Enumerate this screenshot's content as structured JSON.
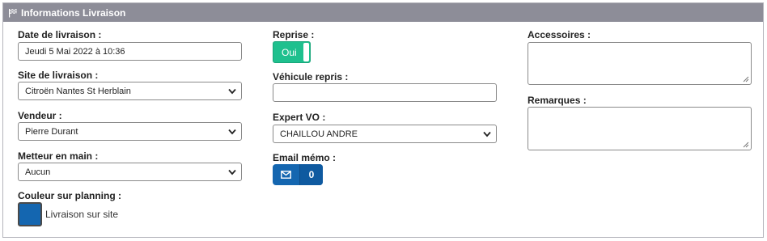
{
  "panel": {
    "title": "Informations Livraison",
    "icon": "flag-icon"
  },
  "col1": {
    "date_label": "Date de livraison :",
    "date_value": "Jeudi 5 Mai 2022 à 10:36",
    "site_label": "Site de livraison :",
    "site_value": "Citroën Nantes St Herblain",
    "vendeur_label": "Vendeur :",
    "vendeur_value": "Pierre Durant",
    "metteur_label": "Metteur en main :",
    "metteur_value": "Aucun",
    "couleur_label": "Couleur sur planning :",
    "couleur_value": "Livraison sur site",
    "couleur_color": "#1466b0"
  },
  "col2": {
    "reprise_label": "Reprise :",
    "reprise_value": "Oui",
    "reprise_color": "#1fc08e",
    "vehicule_label": "Véhicule repris :",
    "vehicule_value": "",
    "expert_label": "Expert VO :",
    "expert_value": "CHAILLOU ANDRE",
    "email_label": "Email mémo :",
    "email_count": "0",
    "email_icon": "envelope-icon"
  },
  "col3": {
    "accessoires_label": "Accessoires :",
    "accessoires_value": "",
    "remarques_label": "Remarques :",
    "remarques_value": ""
  }
}
